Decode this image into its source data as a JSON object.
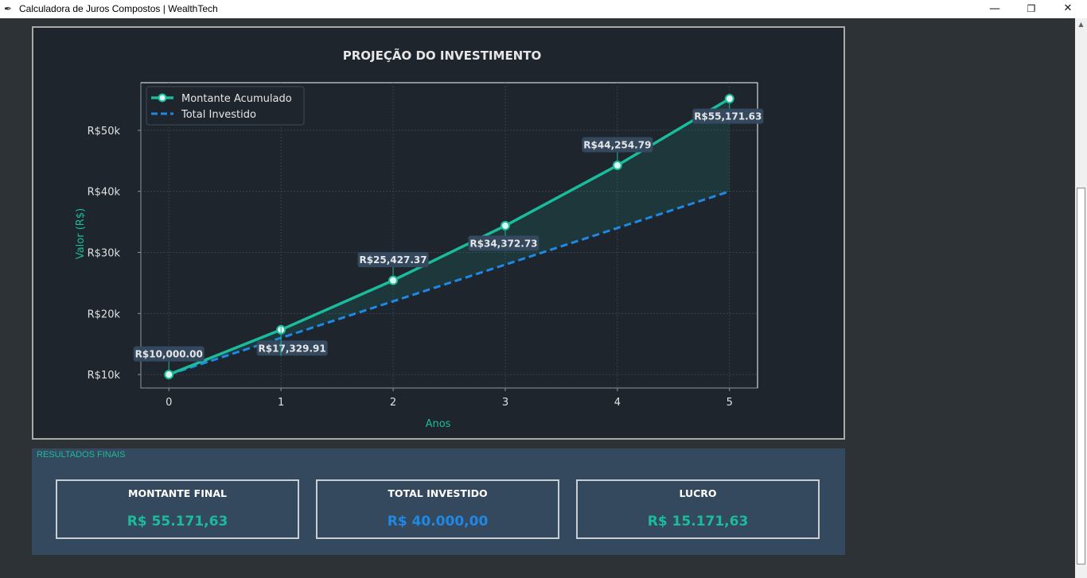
{
  "window": {
    "icon": "feather-icon",
    "title": "Calculadora de Juros Compostos | WealthTech",
    "minimize": "—",
    "maximize": "❐",
    "close": "✕"
  },
  "chart_data": {
    "type": "line",
    "title": "PROJEÇÃO DO INVESTIMENTO",
    "xlabel": "Anos",
    "ylabel": "Valor (R$)",
    "x": [
      0,
      1,
      2,
      3,
      4,
      5
    ],
    "xticks": [
      "0",
      "1",
      "2",
      "3",
      "4",
      "5"
    ],
    "yticks": [
      10000,
      20000,
      30000,
      40000,
      50000
    ],
    "ytick_labels": [
      "R$10k",
      "R$20k",
      "R$30k",
      "R$40k",
      "R$50k"
    ],
    "ylim": [
      7800,
      57800
    ],
    "xlim": [
      -0.25,
      5.25
    ],
    "grid": true,
    "legend_position": "top-left",
    "series": [
      {
        "name": "Montante Acumulado",
        "values": [
          10000.0,
          17329.91,
          25427.37,
          34372.73,
          44254.79,
          55171.63
        ],
        "labels": [
          "R$10,000.00",
          "R$17,329.91",
          "R$25,427.37",
          "R$34,372.73",
          "R$44,254.79",
          "R$55,171.63"
        ],
        "color": "#1abc9c",
        "style": "solid-markers"
      },
      {
        "name": "Total Investido",
        "values": [
          10000,
          16000,
          22000,
          28000,
          34000,
          40000
        ],
        "color": "#1f88e5",
        "style": "dashed"
      }
    ],
    "label_position": [
      "above",
      "right",
      "above",
      "below",
      "above",
      "below"
    ]
  },
  "results": {
    "section_label": "RESULTADOS FINAIS",
    "cards": [
      {
        "title": "MONTANTE FINAL",
        "value": "R$ 55.171,63",
        "color": "#1abc9c"
      },
      {
        "title": "TOTAL INVESTIDO",
        "value": "R$ 40.000,00",
        "color": "#1f88e5"
      },
      {
        "title": "LUCRO",
        "value": "R$ 15.171,63",
        "color": "#1abc9c"
      }
    ]
  },
  "scrollbar": {
    "up_arrow": "▲"
  },
  "colors": {
    "background": "#2c3236",
    "chart_bg": "#1e252d",
    "panel": "#34495e",
    "accent": "#1abc9c",
    "blue": "#1f88e5"
  }
}
